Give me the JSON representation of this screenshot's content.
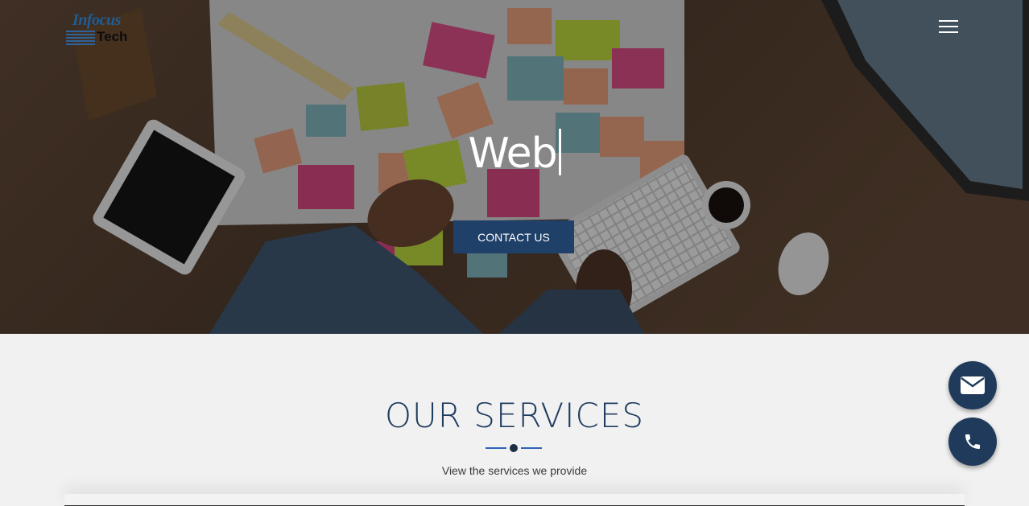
{
  "header": {
    "logo_line1": "Infocus",
    "logo_line2": "Tech",
    "menu_icon": "hamburger-menu-icon"
  },
  "hero": {
    "typed_word": "Web",
    "cta_label": "CONTACT US"
  },
  "services": {
    "title": "OUR SERVICES",
    "subtitle": "View the services we provide"
  },
  "floating_actions": {
    "email_icon": "envelope-icon",
    "phone_icon": "phone-icon"
  },
  "colors": {
    "accent_navy": "#1f4068",
    "divider_blue": "#2e63b8",
    "fab_bg": "#1f3a5a"
  }
}
